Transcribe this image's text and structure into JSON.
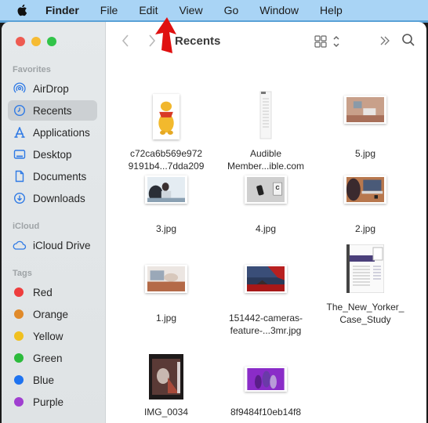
{
  "menubar": {
    "app_name": "Finder",
    "items": [
      "File",
      "Edit",
      "View",
      "Go",
      "Window",
      "Help"
    ],
    "background": "#a9d4f5"
  },
  "window": {
    "traffic_lights": [
      "close",
      "minimize",
      "zoom"
    ]
  },
  "sidebar": {
    "favorites_label": "Favorites",
    "favorites": [
      {
        "label": "AirDrop",
        "icon": "airdrop-icon"
      },
      {
        "label": "Recents",
        "icon": "clock-icon",
        "active": true
      },
      {
        "label": "Applications",
        "icon": "applications-icon"
      },
      {
        "label": "Desktop",
        "icon": "desktop-icon"
      },
      {
        "label": "Documents",
        "icon": "document-icon"
      },
      {
        "label": "Downloads",
        "icon": "download-icon"
      }
    ],
    "icloud_label": "iCloud",
    "icloud": [
      {
        "label": "iCloud Drive",
        "icon": "cloud-icon"
      }
    ],
    "tags_label": "Tags",
    "tags": [
      {
        "label": "Red",
        "color": "#ee3d3d"
      },
      {
        "label": "Orange",
        "color": "#e08a2a"
      },
      {
        "label": "Yellow",
        "color": "#f0c020"
      },
      {
        "label": "Green",
        "color": "#2cbb3c"
      },
      {
        "label": "Blue",
        "color": "#1f73f0"
      },
      {
        "label": "Purple",
        "color": "#a03fd0"
      }
    ]
  },
  "toolbar": {
    "title": "Recents",
    "back_icon": "chevron-left-icon",
    "forward_icon": "chevron-right-icon",
    "view_icon": "grid-view-icon",
    "more_icon": "double-chevron-icon",
    "search_icon": "search-icon"
  },
  "files": [
    {
      "name_line1": "c72ca6b569e972",
      "name_line2": "9191b4...7dda209",
      "kind": "portrait-image"
    },
    {
      "name_line1": "Audible",
      "name_line2": "Member...ible.com",
      "kind": "document"
    },
    {
      "name_line1": "5.jpg",
      "name_line2": "",
      "kind": "landscape-image"
    },
    {
      "name_line1": "3.jpg",
      "name_line2": "",
      "kind": "landscape-image"
    },
    {
      "name_line1": "4.jpg",
      "name_line2": "",
      "kind": "landscape-image"
    },
    {
      "name_line1": "2.jpg",
      "name_line2": "",
      "kind": "landscape-image"
    },
    {
      "name_line1": "1.jpg",
      "name_line2": "",
      "kind": "landscape-image"
    },
    {
      "name_line1": "151442-cameras-",
      "name_line2": "feature-...3mr.jpg",
      "kind": "landscape-image"
    },
    {
      "name_line1": "The_New_Yorker_",
      "name_line2": "Case_Study",
      "kind": "document"
    },
    {
      "name_line1": "IMG_0034",
      "name_line2": "",
      "kind": "portrait-image"
    },
    {
      "name_line1": "8f9484f10eb14f8",
      "name_line2": "",
      "kind": "landscape-image"
    }
  ]
}
